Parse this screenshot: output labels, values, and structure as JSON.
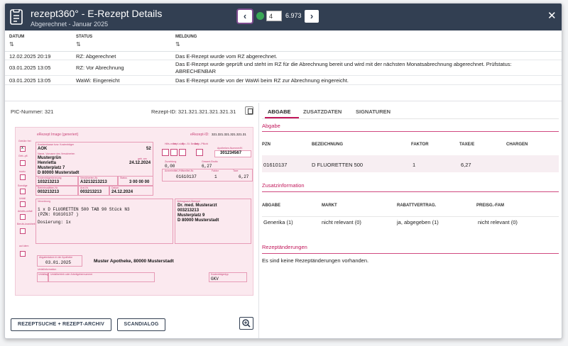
{
  "header": {
    "title": "rezept360° - E-Rezept Details",
    "subtitle": "Abgerechnet - Januar 2025",
    "page_current": "4",
    "page_total": "6.973",
    "prev_label": "‹",
    "next_label": "›",
    "close_label": "✕"
  },
  "status_table": {
    "columns": [
      "DATUM",
      "STATUS",
      "MELDUNG"
    ],
    "sort_icon": "⇅",
    "rows": [
      {
        "datum": "12.02.2025 20:19",
        "status": "RZ: Abgerechnet",
        "meldung": "Das E-Rezept wurde vom RZ abgerechnet."
      },
      {
        "datum": "03.01.2025 13:05",
        "status": "RZ: Vor Abrechnung",
        "meldung": "Das E-Rezept wurde geprüft und steht im RZ für die Abrechnung bereit und wird mit der nächsten Monatsabrechnung abgerechnet. Prüfstatus: ABRECHENBAR"
      },
      {
        "datum": "03.01.2025 13:05",
        "status": "WaWi: Eingereicht",
        "meldung": "Das E-Rezept wurde von der WaWi beim RZ zur Abrechnung eingereicht."
      }
    ]
  },
  "left": {
    "pic_label": "PIC-Nummer: 321",
    "rezept_id_label": "Rezept-ID: 321.321.321.321.321.31",
    "erx": {
      "heading": "eRezept Image (generiert)",
      "id_label": "eRezept-ID:",
      "id_value": "321.321.321.321.321.31",
      "side_labels": [
        "Gebühr frei",
        "Geb.-pfl.",
        "noctu",
        "Sonstige",
        "Unfall",
        "Arbeits-unfall",
        "Berufs-krankheit",
        "aut idem",
        "aut idem",
        "aut idem"
      ],
      "kasse_label": "Krankenkasse bzw. Kostenträger",
      "kasse": "AOK",
      "kasse_nr": "52",
      "patient_label": "Name, Vorname des Versicherten",
      "patient_name": "Mustergrün",
      "patient_vorname": "Henrietta",
      "patient_street": "Musterplatz 7",
      "patient_city": "D 80000 Musterstadt",
      "geb_label": "geb. am",
      "geb": "24.12.2024",
      "kt_label": "Kostenträgerkennung",
      "kt": "103213213",
      "vers_label": "Versicherten-Nr.",
      "vers": "A3213213213",
      "status_label": "Status",
      "status": "3 00 00 00",
      "bsnr_label": "Betriebsstätten-Nr.",
      "bsnr": "003213213",
      "lanr_label": "Arzt-Nr.",
      "lanr": "003213213",
      "datum_label": "Datum",
      "datum": "24.12.2024",
      "hilfs_labels": [
        "Hilfs-mittel",
        "Impf-stoff",
        "Spr.-St. Bedarf",
        "Begr.-Pflicht"
      ],
      "apo_label": "Apotheken-Nummer/IK",
      "apo": "301234567",
      "zuzahlung_label": "Zuzahlung",
      "zuzahlung": "0,00",
      "gesamt_label": "Gesamt-Brutto",
      "gesamt": "6,27",
      "arzneimittel_label": "Arzneimittel-/Hilfsmittel-Nr.",
      "pzn_line": "01610137",
      "faktor_label": "Faktor",
      "faktor": "1",
      "taxe_label": "Taxe",
      "taxe": "6,27",
      "verordnung_label": "Verordnung",
      "verordnung_line1": "1  x  D  FLUORETTEN  500   TAB   90   Stück   N3",
      "verordnung_line2": "(PZN: 01610137 )",
      "verordnung_line3": "Dosierung: 1x",
      "arzt_label": "Vertragsarzt-Stempel",
      "arzt_name": "Dr. med. Musterarzt",
      "arzt_nr": "003213213",
      "arzt_street": "Musterplatz 9",
      "arzt_city": "D 80000 Musterstadt",
      "abgabe_label": "Abgabedatum in der Apotheke",
      "abgabe_datum": "03.01.2025",
      "apotheke": "Muster Apotheke,  80000  Musterstadt",
      "unfall_label": "Unfallinformation",
      "unfalltag_label": "Unfalltag",
      "unfallbetrieb_label": "Unfallbetrieb oder Arbeitgebernummer",
      "kostentraeger_label": "Kostenträgertyp",
      "kostentraeger": "GKV"
    },
    "btn_search": "REZEPTSUCHE + REZEPT-ARCHIV",
    "btn_scan": "SCANDIALOG"
  },
  "right": {
    "tabs": [
      "ABGABE",
      "ZUSATZDATEN",
      "SIGNATUREN"
    ],
    "abgabe_title": "Abgabe",
    "abgabe_columns": [
      "PZN",
      "BEZEICHNUNG",
      "FAKTOR",
      "TAXE/E",
      "CHARGEN"
    ],
    "abgabe_row": {
      "pzn": "01610137",
      "bezeichnung": "D FLUORETTEN 500",
      "faktor": "1",
      "taxe": "6,27",
      "chargen": ""
    },
    "zusatz_title": "Zusatzinformation",
    "zusatz_columns": [
      "ABGABE",
      "MARKT",
      "RABATTVERTRAG.",
      "PREISG.-FAM"
    ],
    "zusatz_row": {
      "abgabe": "Generika (1)",
      "markt": "nicht relevant (0)",
      "rabatt": "ja, abgegeben (1)",
      "preisg": "nicht relevant (0)"
    },
    "aenderungen_title": "Rezeptänderungen",
    "aenderungen_text": "Es sind keine Rezeptänderungen vorhanden."
  },
  "colors": {
    "header_bg": "#323f52",
    "accent": "#c2185b",
    "erx_bg": "#fbe9ef",
    "status_ok": "#3aa757"
  }
}
